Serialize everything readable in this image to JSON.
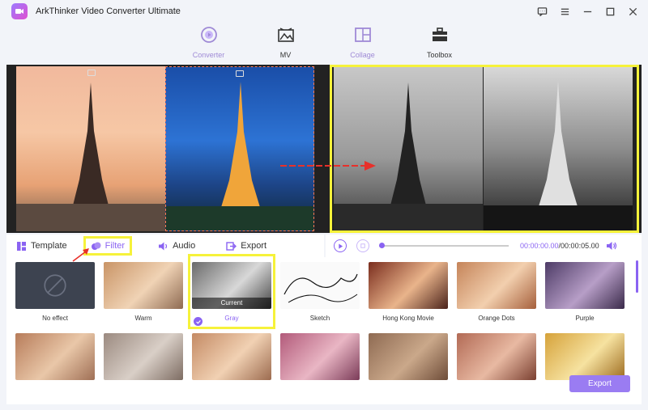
{
  "app": {
    "title": "ArkThinker Video Converter Ultimate"
  },
  "nav": [
    {
      "label": "Converter",
      "icon": "converter-icon"
    },
    {
      "label": "MV",
      "icon": "mv-icon"
    },
    {
      "label": "Collage",
      "icon": "collage-icon"
    },
    {
      "label": "Toolbox",
      "icon": "toolbox-icon"
    }
  ],
  "tabs": {
    "template": "Template",
    "filter": "Filter",
    "audio": "Audio",
    "export": "Export"
  },
  "player": {
    "current_time": "00:00:00.00",
    "total_time": "/00:00:05.00",
    "progress": 0
  },
  "filters": [
    {
      "label": "No effect"
    },
    {
      "label": "Warm"
    },
    {
      "label": "Gray",
      "selected": true,
      "badge": "Current"
    },
    {
      "label": "Sketch"
    },
    {
      "label": "Hong Kong Movie"
    },
    {
      "label": "Orange Dots"
    },
    {
      "label": "Purple"
    }
  ],
  "export_button": "Export",
  "colors": {
    "accent": "#8a63f2",
    "highlight": "#f6f23a"
  }
}
